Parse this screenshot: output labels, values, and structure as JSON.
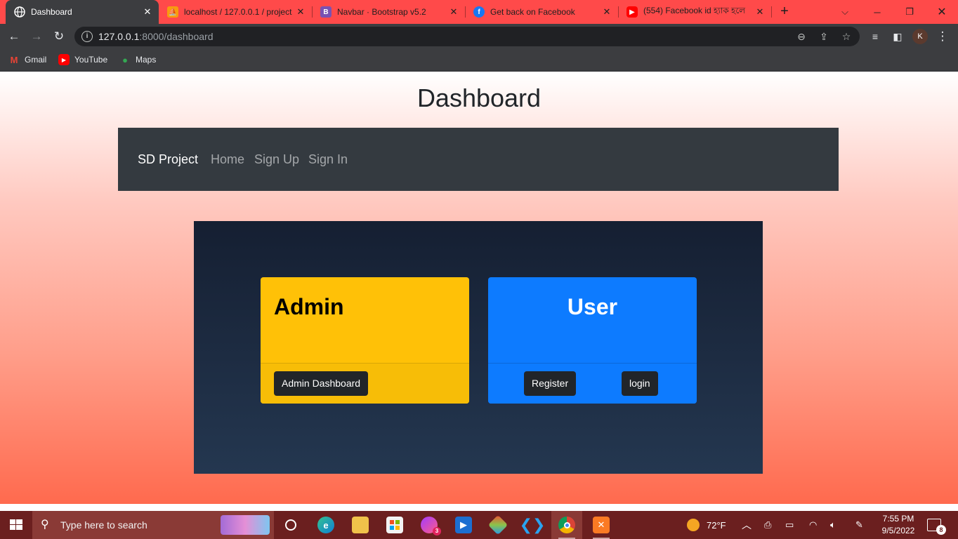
{
  "browser": {
    "tabs": [
      {
        "title": "Dashboard",
        "active": true,
        "favicon": "globe-icon",
        "color": "#ffffff"
      },
      {
        "title": "localhost / 127.0.0.1 / project",
        "active": false,
        "favicon": "phpmyadmin-icon",
        "color": "#f89c0e"
      },
      {
        "title": "Navbar · Bootstrap v5.2",
        "active": false,
        "favicon": "bootstrap-icon",
        "color": "#7952b3"
      },
      {
        "title": "Get back on Facebook",
        "active": false,
        "favicon": "facebook-icon",
        "color": "#1877f2"
      },
      {
        "title": "(554) Facebook id হ্যাক হলে",
        "active": false,
        "favicon": "youtube-icon",
        "color": "#ff0000"
      }
    ],
    "url_host": "127.0.0.1",
    "url_path": ":8000/dashboard",
    "avatar_letter": "K",
    "bookmarks": [
      {
        "label": "Gmail",
        "icon": "gmail-icon"
      },
      {
        "label": "YouTube",
        "icon": "youtube-icon"
      },
      {
        "label": "Maps",
        "icon": "maps-icon"
      }
    ]
  },
  "page": {
    "title": "Dashboard",
    "navbar": {
      "brand": "SD Project",
      "links": [
        "Home",
        "Sign Up",
        "Sign In"
      ]
    },
    "cards": {
      "admin": {
        "title": "Admin",
        "button": "Admin Dashboard",
        "color": "#ffc107"
      },
      "user": {
        "title": "User",
        "buttons": [
          "Register",
          "login"
        ],
        "color": "#0d7bff"
      }
    }
  },
  "taskbar": {
    "search_placeholder": "Type here to search",
    "weather": "72°F",
    "time": "7:55 PM",
    "date": "9/5/2022",
    "notification_count": "8",
    "messenger_badge": "3"
  }
}
